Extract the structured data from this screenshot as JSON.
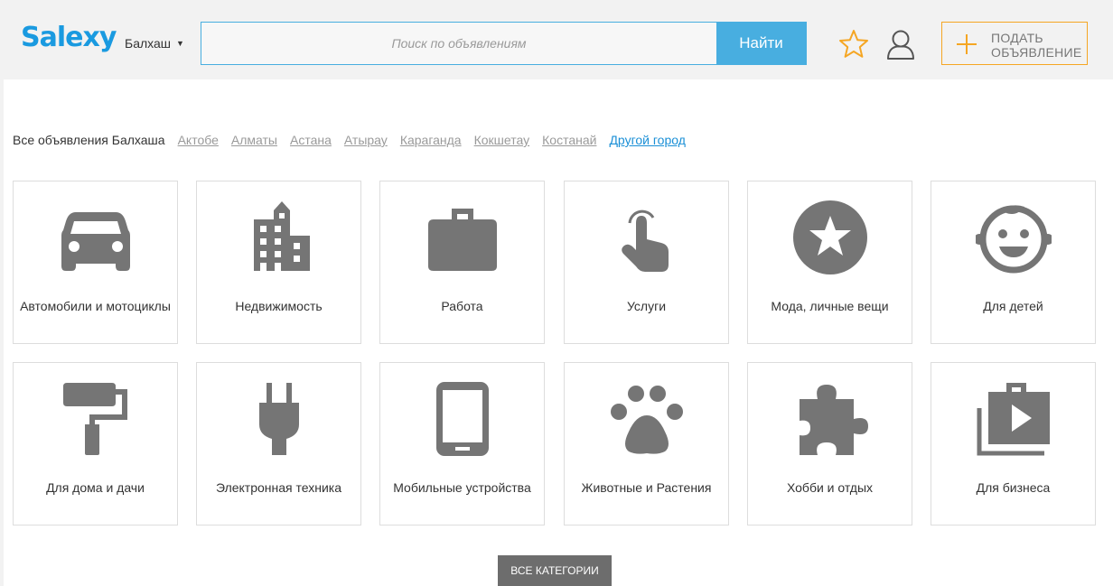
{
  "header": {
    "logo": "Salexy",
    "city": "Балхаш",
    "search_placeholder": "Поиск по объявлениям",
    "search_button": "Найти",
    "post_line1": "ПОДАТЬ",
    "post_line2": "ОБЪЯВЛЕНИЕ"
  },
  "cities": {
    "label": "Все объявления Балхаша",
    "links": [
      "Актобе",
      "Алматы",
      "Астана",
      "Атырау",
      "Караганда",
      "Кокшетау",
      "Костанай"
    ],
    "other": "Другой город"
  },
  "categories": [
    {
      "label": "Автомобили и мотоциклы",
      "icon": "car-icon"
    },
    {
      "label": "Недвижимость",
      "icon": "building-icon"
    },
    {
      "label": "Работа",
      "icon": "briefcase-icon"
    },
    {
      "label": "Услуги",
      "icon": "hand-pointer-icon"
    },
    {
      "label": "Мода, личные вещи",
      "icon": "star-circle-icon"
    },
    {
      "label": "Для детей",
      "icon": "baby-face-icon"
    },
    {
      "label": "Для дома и дачи",
      "icon": "paint-roller-icon"
    },
    {
      "label": "Электронная техника",
      "icon": "plug-icon"
    },
    {
      "label": "Мобильные устройства",
      "icon": "smartphone-icon"
    },
    {
      "label": "Животные и Растения",
      "icon": "paw-icon"
    },
    {
      "label": "Хобби и отдых",
      "icon": "puzzle-icon"
    },
    {
      "label": "Для бизнеса",
      "icon": "business-video-icon"
    }
  ],
  "all_categories_button": "ВСЕ КАТЕГОРИИ",
  "colors": {
    "brand": "#1a9ae0",
    "search_button": "#48aee0",
    "post_border": "#f5a623",
    "icon": "#757575"
  }
}
